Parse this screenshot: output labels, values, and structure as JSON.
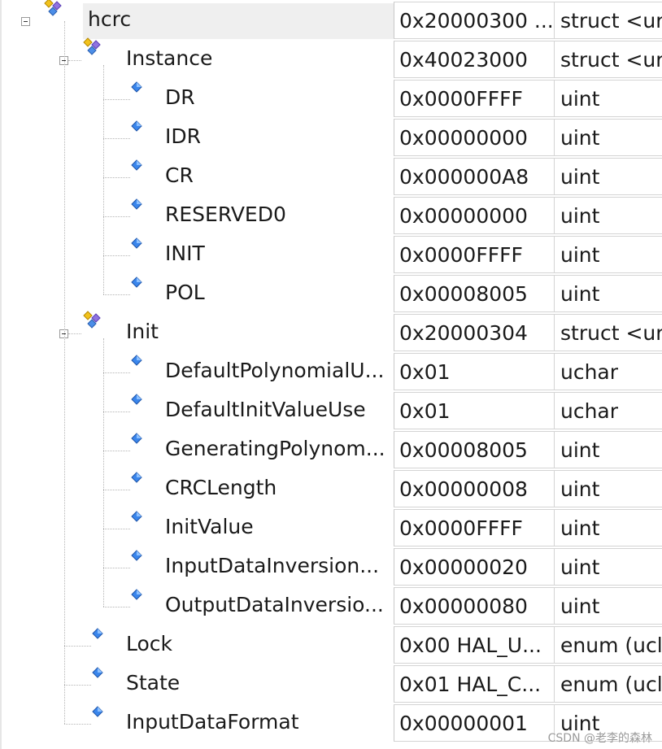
{
  "watch": {
    "rows": [
      {
        "name": "hcrc",
        "value": "0x20000300 ...",
        "type": "struct <ur",
        "depth": 0,
        "kind": "struct",
        "expanded": true
      },
      {
        "name": "Instance",
        "value": "0x40023000",
        "type": "struct <ur",
        "depth": 1,
        "kind": "struct",
        "expanded": true
      },
      {
        "name": "DR",
        "value": "0x0000FFFF",
        "type": "uint",
        "depth": 2,
        "kind": "field"
      },
      {
        "name": "IDR",
        "value": "0x00000000",
        "type": "uint",
        "depth": 2,
        "kind": "field"
      },
      {
        "name": "CR",
        "value": "0x000000A8",
        "type": "uint",
        "depth": 2,
        "kind": "field"
      },
      {
        "name": "RESERVED0",
        "value": "0x00000000",
        "type": "uint",
        "depth": 2,
        "kind": "field"
      },
      {
        "name": "INIT",
        "value": "0x0000FFFF",
        "type": "uint",
        "depth": 2,
        "kind": "field"
      },
      {
        "name": "POL",
        "value": "0x00008005",
        "type": "uint",
        "depth": 2,
        "kind": "field"
      },
      {
        "name": "Init",
        "value": "0x20000304",
        "type": "struct <ur",
        "depth": 1,
        "kind": "struct",
        "expanded": true
      },
      {
        "name": "DefaultPolynomialU...",
        "value": "0x01",
        "type": "uchar",
        "depth": 2,
        "kind": "field"
      },
      {
        "name": "DefaultInitValueUse",
        "value": "0x01",
        "type": "uchar",
        "depth": 2,
        "kind": "field"
      },
      {
        "name": "GeneratingPolynom...",
        "value": "0x00008005",
        "type": "uint",
        "depth": 2,
        "kind": "field"
      },
      {
        "name": "CRCLength",
        "value": "0x00000008",
        "type": "uint",
        "depth": 2,
        "kind": "field"
      },
      {
        "name": "InitValue",
        "value": "0x0000FFFF",
        "type": "uint",
        "depth": 2,
        "kind": "field"
      },
      {
        "name": "InputDataInversion...",
        "value": "0x00000020",
        "type": "uint",
        "depth": 2,
        "kind": "field"
      },
      {
        "name": "OutputDataInversio...",
        "value": "0x00000080",
        "type": "uint",
        "depth": 2,
        "kind": "field"
      },
      {
        "name": "Lock",
        "value": "0x00 HAL_U...",
        "type": "enum (ucl",
        "depth": 1,
        "kind": "field"
      },
      {
        "name": "State",
        "value": "0x01 HAL_C...",
        "type": "enum (ucl",
        "depth": 1,
        "kind": "field"
      },
      {
        "name": "InputDataFormat",
        "value": "0x00000001",
        "type": "uint",
        "depth": 1,
        "kind": "field"
      }
    ]
  },
  "icons": {
    "struct": "struct-member-icon",
    "field": "field-member-icon",
    "expander": "collapse-toggle-icon"
  },
  "colors": {
    "field_blue": "#2a6fd6",
    "struct_gold": "#e0a800",
    "struct_purple": "#7a5bd1",
    "selected_row": "#efefef"
  },
  "watermark": "CSDN @老李的森林"
}
